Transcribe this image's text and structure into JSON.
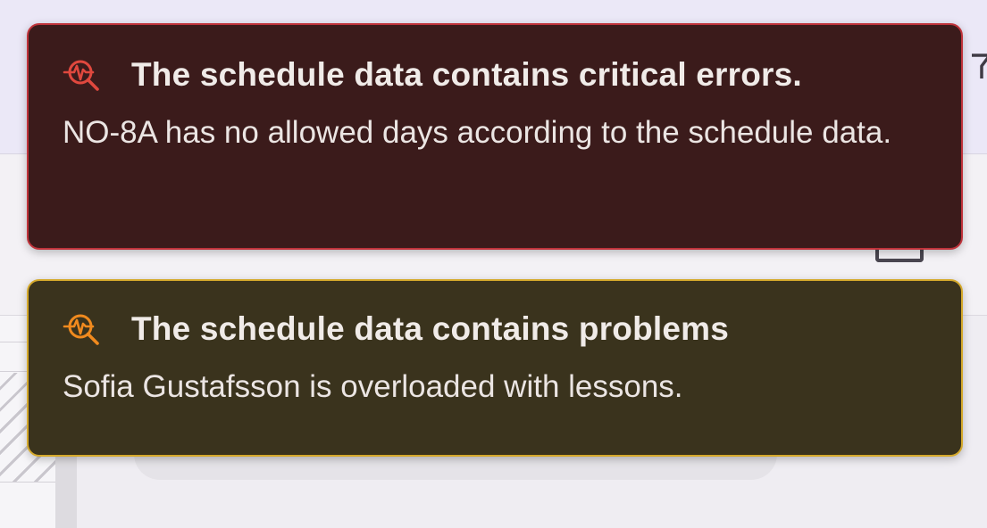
{
  "colors": {
    "error_bg": "#3b1b1b",
    "error_border": "#c0333b",
    "error_icon": "#e0483e",
    "warning_bg": "#3a331d",
    "warning_border": "#d5a92b",
    "warning_icon": "#f08a1e"
  },
  "toasts": [
    {
      "severity": "critical",
      "icon": "search-pulse-icon",
      "title": "The schedule data contains critical errors.",
      "message": "NO-8A has no allowed days according to the schedule data."
    },
    {
      "severity": "warning",
      "icon": "search-pulse-icon",
      "title": "The schedule data contains problems",
      "message": "Sofia Gustafsson is overloaded with lessons."
    }
  ]
}
